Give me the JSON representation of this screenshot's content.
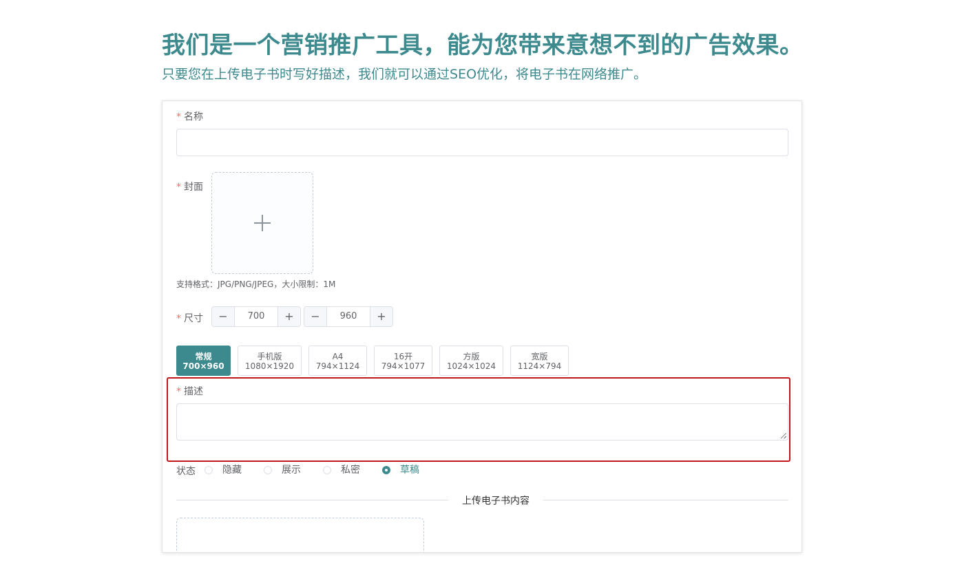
{
  "hero": {
    "title": "我们是一个营销推广工具，能为您带来意想不到的广告效果。",
    "subtitle": "只要您在上传电子书时写好描述，我们就可以通过SEO优化，将电子书在网络推广。"
  },
  "form": {
    "required_mark": "*",
    "name": {
      "label": "名称",
      "value": ""
    },
    "cover": {
      "label": "封面",
      "hint": "支持格式：JPG/PNG/JPEG，大小限制：1M",
      "upload_icon": "plus-icon"
    },
    "size": {
      "label": "尺寸",
      "width": "700",
      "height": "960",
      "decrement_label": "−",
      "increment_label": "+"
    },
    "presets": [
      {
        "name": "常规",
        "dims": "700×960",
        "active": true
      },
      {
        "name": "手机版",
        "dims": "1080×1920",
        "active": false
      },
      {
        "name": "A4",
        "dims": "794×1124",
        "active": false
      },
      {
        "name": "16开",
        "dims": "794×1077",
        "active": false
      },
      {
        "name": "方版",
        "dims": "1024×1024",
        "active": false
      },
      {
        "name": "宽版",
        "dims": "1124×794",
        "active": false
      }
    ],
    "description": {
      "label": "描述",
      "value": ""
    },
    "status": {
      "label": "状态",
      "options": [
        {
          "label": "隐藏",
          "checked": false
        },
        {
          "label": "展示",
          "checked": false
        },
        {
          "label": "私密",
          "checked": false
        },
        {
          "label": "草稿",
          "checked": true
        }
      ]
    },
    "upload_section": {
      "divider_text": "上传电子书内容"
    }
  },
  "colors": {
    "accent": "#3d8a8e",
    "required": "#f56c6c",
    "highlight_border": "#c0161c"
  }
}
